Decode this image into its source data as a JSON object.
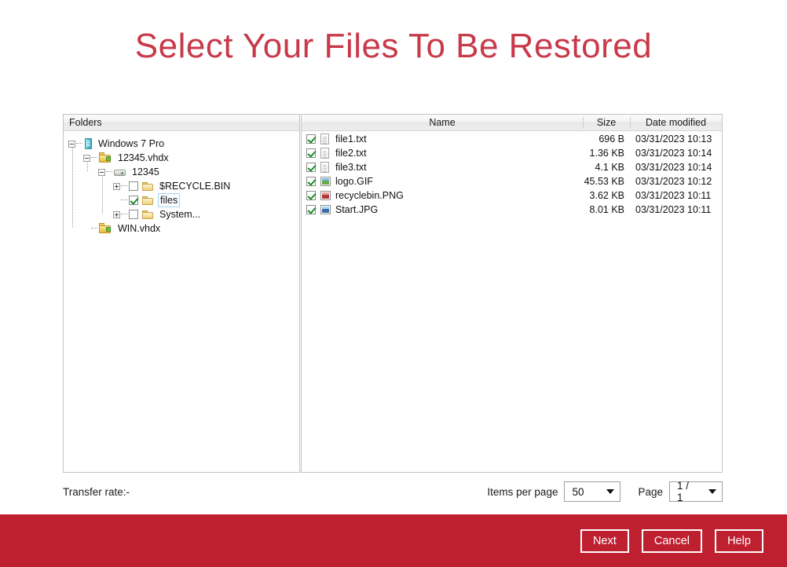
{
  "page": {
    "title": "Select Your Files To Be Restored",
    "accent_red": "#be2030",
    "title_color": "#c8394a"
  },
  "tree": {
    "header": "Folders",
    "nodes": [
      {
        "label": "Windows 7 Pro",
        "icon": "computer-icon",
        "depth": 0,
        "expander": "minus",
        "checkbox": "none",
        "selected": false
      },
      {
        "label": "12345.vhdx",
        "icon": "vhd-disk-icon",
        "depth": 1,
        "expander": "minus",
        "checkbox": "none",
        "selected": false
      },
      {
        "label": "12345",
        "icon": "drive-icon",
        "depth": 2,
        "expander": "minus",
        "checkbox": "none",
        "selected": false
      },
      {
        "label": "$RECYCLE.BIN",
        "icon": "folder-icon",
        "depth": 3,
        "expander": "plus",
        "checkbox": "unchecked",
        "selected": false
      },
      {
        "label": "files",
        "icon": "folder-icon",
        "depth": 3,
        "expander": "none",
        "checkbox": "checked",
        "selected": true
      },
      {
        "label": "System...",
        "icon": "folder-icon",
        "depth": 3,
        "expander": "plus",
        "checkbox": "unchecked",
        "selected": false
      },
      {
        "label": "WIN.vhdx",
        "icon": "vhd-disk-icon",
        "depth": 1,
        "expander": "none",
        "checkbox": "none",
        "selected": false
      }
    ]
  },
  "file_list": {
    "columns": {
      "name": "Name",
      "size": "Size",
      "date": "Date modified"
    },
    "rows": [
      {
        "name": "file1.txt",
        "size": "696 B",
        "date": "03/31/2023 10:13",
        "checked": true,
        "icon": "text-file-icon"
      },
      {
        "name": "file2.txt",
        "size": "1.36 KB",
        "date": "03/31/2023 10:14",
        "checked": true,
        "icon": "text-file-icon"
      },
      {
        "name": "file3.txt",
        "size": "4.1 KB",
        "date": "03/31/2023 10:14",
        "checked": true,
        "icon": "text-file-icon"
      },
      {
        "name": "logo.GIF",
        "size": "45.53 KB",
        "date": "03/31/2023 10:12",
        "checked": true,
        "icon": "image-file-icon"
      },
      {
        "name": "recyclebin.PNG",
        "size": "3.62 KB",
        "date": "03/31/2023 10:11",
        "checked": true,
        "icon": "image-file-icon"
      },
      {
        "name": "Start.JPG",
        "size": "8.01 KB",
        "date": "03/31/2023 10:11",
        "checked": true,
        "icon": "image-file-icon"
      }
    ]
  },
  "controls": {
    "transfer_rate": "Transfer rate:-",
    "items_per_page_label": "Items per page",
    "items_per_page_value": "50",
    "page_label": "Page",
    "page_value": "1 / 1"
  },
  "actions": {
    "next": "Next",
    "cancel": "Cancel",
    "help": "Help"
  }
}
